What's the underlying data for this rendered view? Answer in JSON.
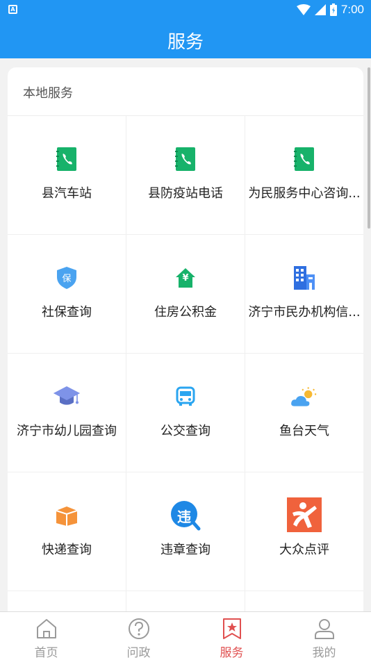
{
  "status_bar": {
    "time": "7:00",
    "left_icon_letter": "A"
  },
  "app_bar": {
    "title": "服务"
  },
  "section": {
    "title": "本地服务"
  },
  "services": [
    {
      "label": "县汽车站",
      "icon": "phone-book-icon"
    },
    {
      "label": "县防疫站电话",
      "icon": "phone-book-icon"
    },
    {
      "label": "为民服务中心咨询...",
      "icon": "phone-book-icon"
    },
    {
      "label": "社保查询",
      "icon": "shield-insurance-icon"
    },
    {
      "label": "住房公积金",
      "icon": "house-yuan-icon"
    },
    {
      "label": "济宁市民办机构信...",
      "icon": "building-icon"
    },
    {
      "label": "济宁市幼儿园查询",
      "icon": "graduation-cap-icon"
    },
    {
      "label": "公交查询",
      "icon": "bus-icon"
    },
    {
      "label": "鱼台天气",
      "icon": "weather-icon"
    },
    {
      "label": "快递查询",
      "icon": "package-icon"
    },
    {
      "label": "违章查询",
      "icon": "violation-icon"
    },
    {
      "label": "大众点评",
      "icon": "dianping-icon"
    }
  ],
  "violation_icon_char": "违",
  "insurance_icon_char": "保",
  "yuan_char": "¥",
  "tabs": [
    {
      "label": "首页",
      "icon": "home-icon",
      "active": false
    },
    {
      "label": "问政",
      "icon": "question-icon",
      "active": false
    },
    {
      "label": "服务",
      "icon": "bookmark-star-icon",
      "active": true
    },
    {
      "label": "我的",
      "icon": "user-icon",
      "active": false
    }
  ],
  "colors": {
    "primary": "#2196f3",
    "active_tab": "#e05050",
    "green": "#17b26a",
    "orange": "#f5933a"
  }
}
